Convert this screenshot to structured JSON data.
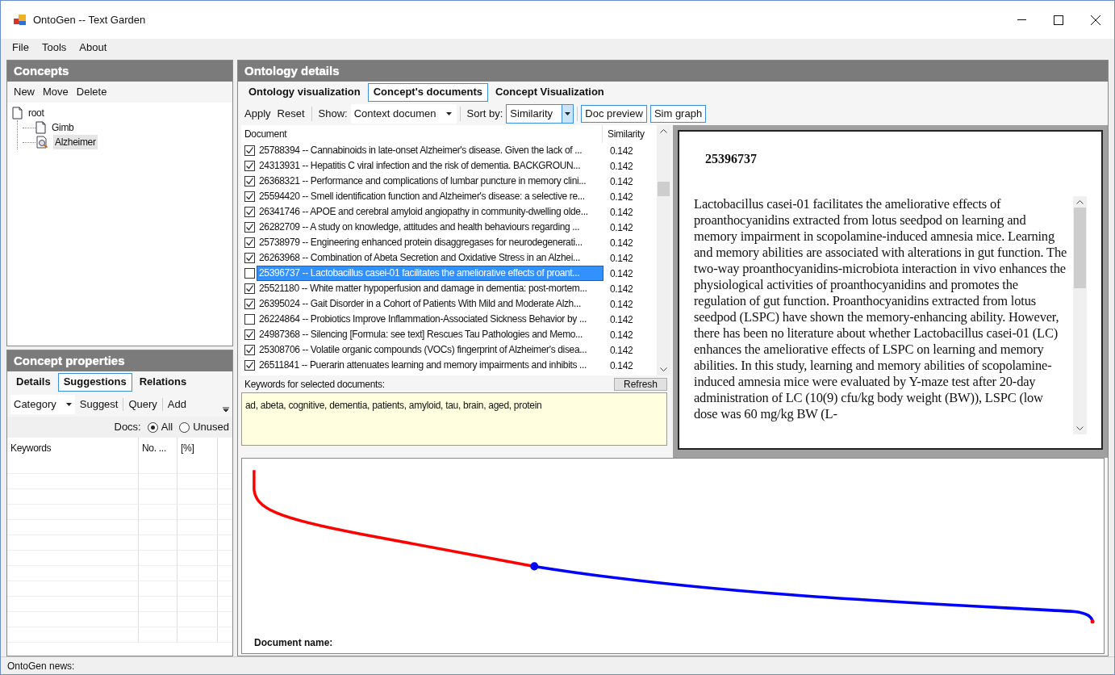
{
  "window": {
    "title": "OntoGen -- Text Garden"
  },
  "menu": [
    "File",
    "Tools",
    "About"
  ],
  "concepts": {
    "title": "Concepts",
    "toolbar": [
      "New",
      "Move",
      "Delete"
    ],
    "tree": [
      {
        "label": "root",
        "kind": "document",
        "selected": false,
        "children": [
          {
            "label": "Gimb",
            "kind": "document",
            "selected": false
          },
          {
            "label": "Alzheimer",
            "kind": "search",
            "selected": true
          }
        ]
      }
    ]
  },
  "concept_properties": {
    "title": "Concept properties",
    "tabs": [
      {
        "label": "Details",
        "selected": false
      },
      {
        "label": "Suggestions",
        "selected": true
      },
      {
        "label": "Relations",
        "selected": false
      }
    ],
    "category": "Category",
    "toolbar": [
      "Suggest",
      "Query",
      "Add"
    ],
    "docs_label": "Docs:",
    "docs_options": [
      {
        "label": "All",
        "selected": true
      },
      {
        "label": "Unused",
        "selected": false
      }
    ],
    "columns": [
      "Keywords",
      "No. ...",
      "[%]"
    ]
  },
  "ontology_details": {
    "title": "Ontology details",
    "tabs": [
      {
        "label": "Ontology visualization",
        "selected": false
      },
      {
        "label": "Concept's documents",
        "selected": true
      },
      {
        "label": "Concept Visualization",
        "selected": false
      }
    ],
    "toolbar": {
      "buttons": [
        "Apply",
        "Reset"
      ],
      "show_label": "Show:",
      "show_value": "Context documen",
      "sort_label": "Sort by:",
      "sort_value": "Similarity",
      "toggles": [
        {
          "label": "Doc preview",
          "on": true
        },
        {
          "label": "Sim graph",
          "on": true
        }
      ]
    },
    "columns": [
      "Document",
      "Similarity"
    ],
    "rows": [
      {
        "checked": true,
        "selected": false,
        "text": "25788394 -- Cannabinoids in late-onset Alzheimer's disease. Given the lack of ...",
        "similarity": "0.142"
      },
      {
        "checked": true,
        "selected": false,
        "text": "24313931 -- Hepatitis C viral infection and the risk of dementia. BACKGROUN...",
        "similarity": "0.142"
      },
      {
        "checked": true,
        "selected": false,
        "text": "26368321 -- Performance and complications of lumbar puncture in memory clini...",
        "similarity": "0.142"
      },
      {
        "checked": true,
        "selected": false,
        "text": "25594420 -- Smell identification function and Alzheimer's disease: a selective re...",
        "similarity": "0.142"
      },
      {
        "checked": true,
        "selected": false,
        "text": "26341746 -- APOE and cerebral amyloid angiopathy in community-dwelling olde...",
        "similarity": "0.142"
      },
      {
        "checked": true,
        "selected": false,
        "text": "26282709 -- A study on knowledge, attitudes and health behaviours regarding ...",
        "similarity": "0.142"
      },
      {
        "checked": true,
        "selected": false,
        "text": "25738979 -- Engineering enhanced protein disaggregases for neurodegenerati...",
        "similarity": "0.142"
      },
      {
        "checked": true,
        "selected": false,
        "text": "26263968 -- Combination of Abeta Secretion and Oxidative Stress in an Alzhei...",
        "similarity": "0.142"
      },
      {
        "checked": false,
        "selected": true,
        "text": "25396737 -- Lactobacillus casei-01 facilitates the ameliorative effects of proant...",
        "similarity": "0.142"
      },
      {
        "checked": true,
        "selected": false,
        "text": "25521180 -- White matter hypoperfusion and damage in dementia: post-mortem...",
        "similarity": "0.142"
      },
      {
        "checked": true,
        "selected": false,
        "text": "26395024 -- Gait Disorder in a Cohort of Patients With Mild and Moderate Alzh...",
        "similarity": "0.142"
      },
      {
        "checked": false,
        "selected": false,
        "text": "26224864 -- Probiotics Improve Inflammation-Associated Sickness Behavior by ...",
        "similarity": "0.142"
      },
      {
        "checked": true,
        "selected": false,
        "text": "24987368 -- Silencing [Formula: see text] Rescues Tau Pathologies and Memo...",
        "similarity": "0.142"
      },
      {
        "checked": true,
        "selected": false,
        "text": "25308706 -- Volatile organic compounds (VOCs) fingerprint of Alzheimer's disea...",
        "similarity": "0.142"
      },
      {
        "checked": true,
        "selected": false,
        "text": "26511841 -- Puerarin attenuates learning and memory impairments and inhibits ...",
        "similarity": "0.142"
      }
    ],
    "keywords_label": "Keywords for selected documents:",
    "refresh": "Refresh",
    "keywords": "ad, abeta, cognitive, dementia, patients, amyloid, tau, brain, aged, protein",
    "preview": {
      "title": "25396737",
      "body": "Lactobacillus casei-01 facilitates the ameliorative effects of proanthocyanidins extracted from lotus seedpod on learning and memory impairment in scopolamine-induced amnesia mice. Learning and memory abilities are associated with alterations in gut function. The two-way proanthocyanidins-microbiota interaction in vivo enhances the physiological activities of proanthocyanidins and promotes the regulation of gut function. Proanthocyanidins extracted from lotus seedpod (LSPC) have shown the memory-enhancing ability. However, there has been no literature about whether Lactobacillus casei-01 (LC) enhances the ameliorative effects of LSPC on learning and memory abilities. In this study, learning and memory abilities of scopolamine-induced amnesia mice were evaluated by Y-maze test after 20-day administration of LC (10(9) cfu/kg body weight (BW)), LSPC (low dose was 60 mg/kg BW (L-"
    },
    "graph_label": "Document name:"
  },
  "status_bar": "OntoGen news:"
}
